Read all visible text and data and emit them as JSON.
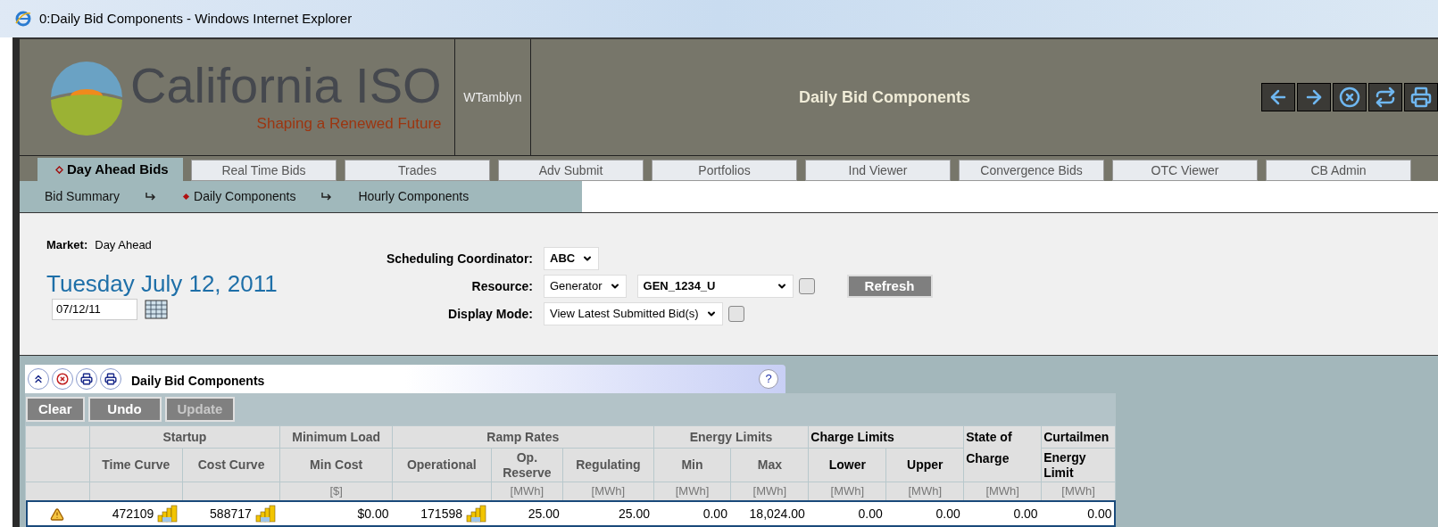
{
  "window": {
    "title": "0:Daily Bid Components - Windows Internet Explorer"
  },
  "header": {
    "logo_name": "California ISO",
    "logo_tagline": "Shaping a Renewed Future",
    "user": "WTamblyn",
    "title": "Daily Bid Components"
  },
  "tabs": [
    {
      "label": "Day Ahead Bids",
      "selected": true
    },
    {
      "label": "Real Time Bids",
      "selected": false
    },
    {
      "label": "Trades",
      "selected": false
    },
    {
      "label": "Adv Submit",
      "selected": false
    },
    {
      "label": "Portfolios",
      "selected": false
    },
    {
      "label": "Ind Viewer",
      "selected": false
    },
    {
      "label": "Convergence Bids",
      "selected": false
    },
    {
      "label": "OTC Viewer",
      "selected": false
    },
    {
      "label": "CB Admin",
      "selected": false
    }
  ],
  "subnav": [
    {
      "label": "Bid Summary",
      "selected": false
    },
    {
      "label": "Daily Components",
      "selected": true
    },
    {
      "label": "Hourly Components",
      "selected": false
    }
  ],
  "form": {
    "market_label": "Market:",
    "market_value": "Day Ahead",
    "date_heading": "Tuesday July 12, 2011",
    "date_value": "07/12/11",
    "fields": [
      {
        "label": "Scheduling Coordinator:",
        "selects": [
          {
            "value": "ABC",
            "bold": true
          }
        ]
      },
      {
        "label": "Resource:",
        "selects": [
          {
            "value": "Generator",
            "bold": false
          },
          {
            "value": "GEN_1234_U",
            "bold": true
          }
        ],
        "checkbox": {
          "checked": false
        },
        "button": "Refresh"
      },
      {
        "label": "Display Mode:",
        "selects": [
          {
            "value": "View Latest Submitted Bid(s)",
            "bold": false
          }
        ],
        "checkbox": {
          "checked": false
        }
      }
    ]
  },
  "panel": {
    "title": "Daily Bid Components",
    "help": "?",
    "buttons": [
      {
        "label": "Clear",
        "disabled": false
      },
      {
        "label": "Undo",
        "disabled": false
      },
      {
        "label": "Update",
        "disabled": true
      }
    ],
    "table": {
      "groups": [
        {
          "tall": false
        },
        {
          "label": "Startup",
          "dark": false,
          "tall": false
        },
        {
          "label": "Minimum Load",
          "dark": false,
          "tall": false
        },
        {
          "label": "Ramp Rates",
          "dark": false,
          "tall": false
        },
        {
          "label": "Energy Limits",
          "dark": false,
          "tall": false
        },
        {
          "label": "Charge Limits",
          "dark": true,
          "tall": false
        },
        {
          "label": "State of Charge",
          "dark": true,
          "tall": true
        },
        {
          "label": "Curtailmen",
          "dark": true,
          "tall": false
        }
      ],
      "columns": [
        {},
        {
          "label": "Time Curve"
        },
        {
          "label": "Cost Curve"
        },
        {
          "label": "Min Cost",
          "unit": "[$]"
        },
        {
          "label": "Operational"
        },
        {
          "label": "Op. Reserve",
          "unit": "[MWh]"
        },
        {
          "label": "Regulating",
          "unit": "[MWh]"
        },
        {
          "label": "Min",
          "unit": "[MWh]"
        },
        {
          "label": "Max",
          "unit": "[MWh]"
        },
        {
          "label": "Lower",
          "unit": "[MWh]"
        },
        {
          "label": "Upper",
          "unit": "[MWh]"
        },
        {
          "unit": "[MWh]"
        },
        {
          "label": "Energy Limit",
          "unit": "[MWh]"
        }
      ],
      "rows": [
        {
          "cells": [
            {
              "kind": "warning"
            },
            {
              "kind": "curve",
              "text": "472109"
            },
            {
              "kind": "curve",
              "text": "588717"
            },
            {
              "kind": "plain",
              "text": "$0.00"
            },
            {
              "kind": "curve",
              "text": "171598"
            },
            {
              "kind": "plain",
              "text": "25.00"
            },
            {
              "kind": "plain",
              "text": "25.00"
            },
            {
              "kind": "plain",
              "text": "0.00"
            },
            {
              "kind": "plain",
              "text": "18,024.00"
            },
            {
              "kind": "plain",
              "text": "0.00"
            },
            {
              "kind": "plain",
              "text": "0.00"
            },
            {
              "kind": "plain",
              "text": "0.00"
            },
            {
              "kind": "plain",
              "text": "0.00"
            }
          ]
        }
      ]
    }
  }
}
